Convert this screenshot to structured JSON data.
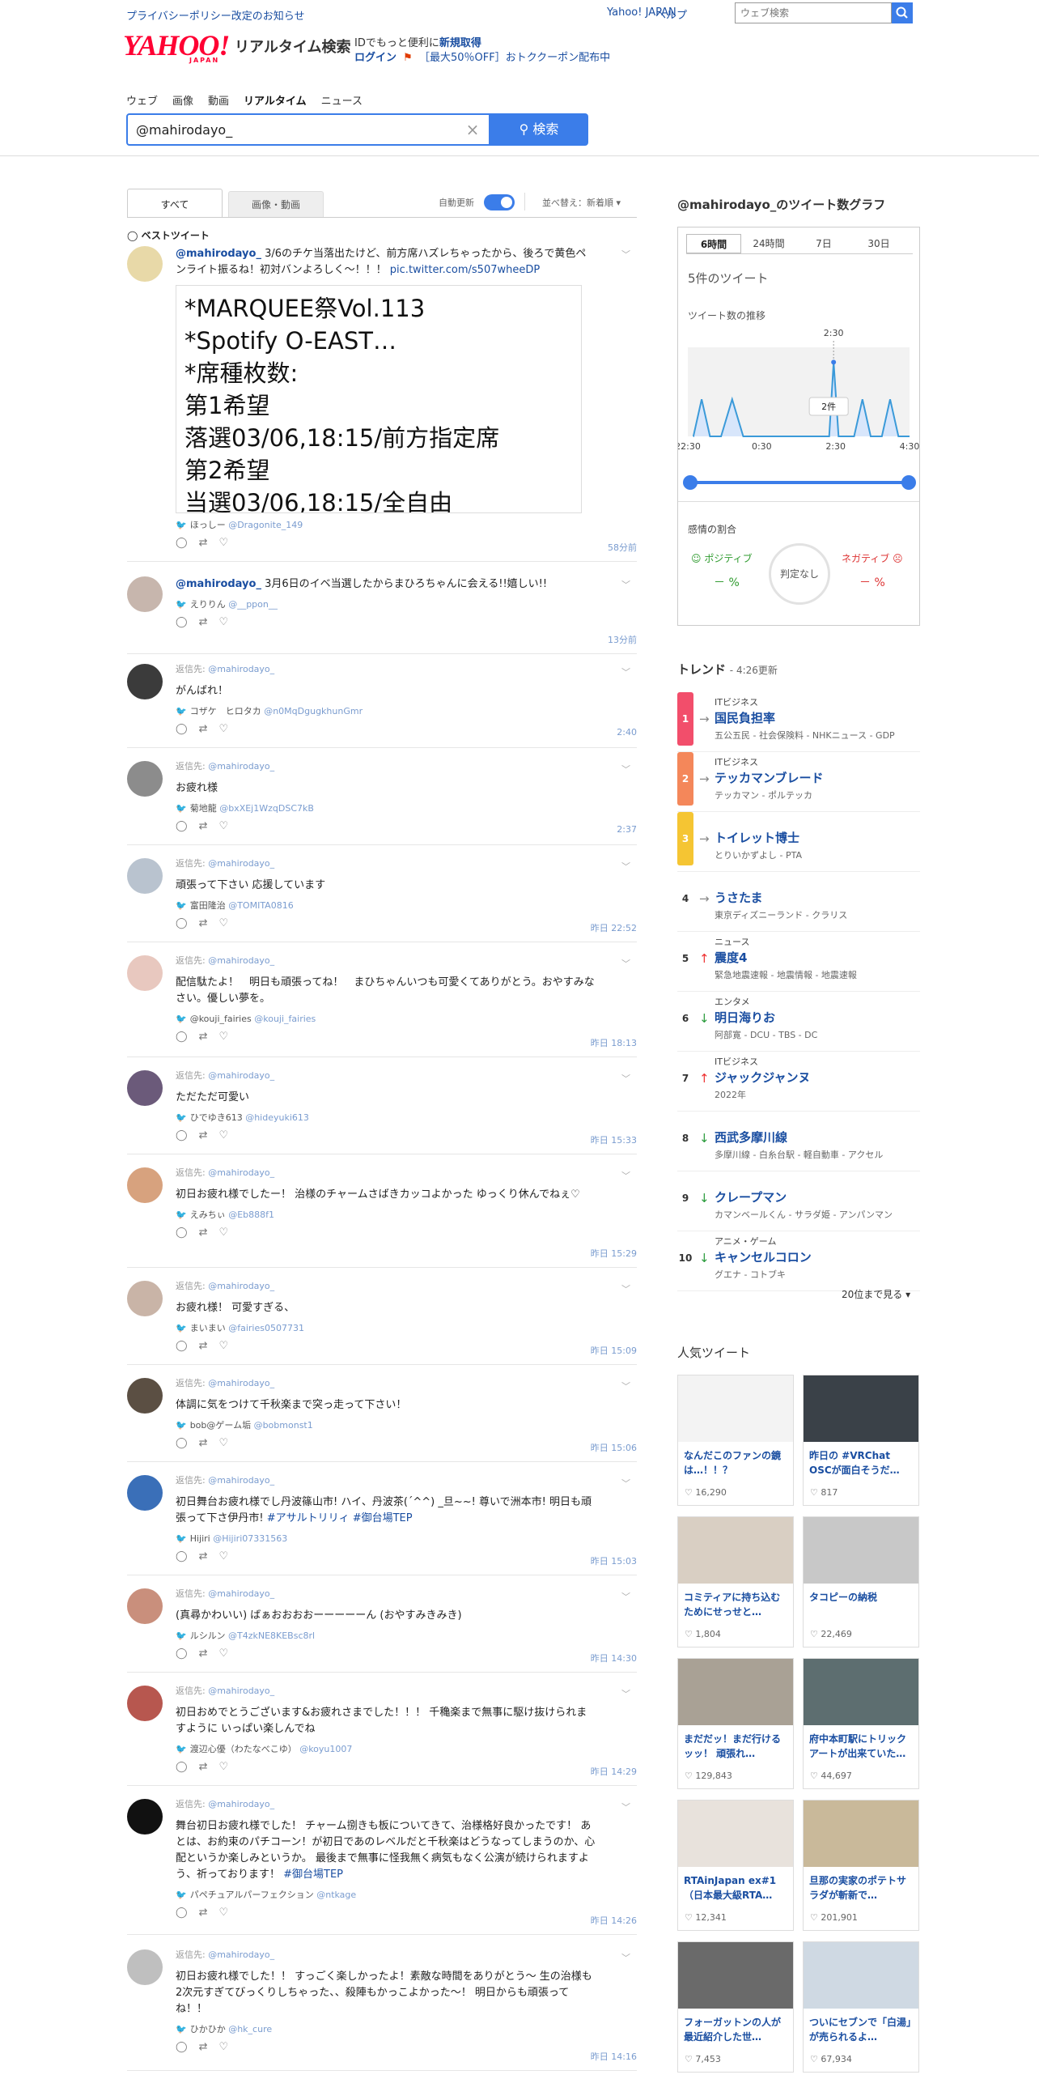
{
  "topbar": {
    "notice": "プライバシーポリシー改定のお知らせ",
    "yjapan": "Yahoo! JAPAN",
    "help": "ヘルプ",
    "websearch_placeholder": "ウェブ検索"
  },
  "header": {
    "logo": "YAHOO!",
    "logo_sub": "JAPAN",
    "service": "リアルタイム検索",
    "id_text": "IDでもっと便利に",
    "id_link": "新規取得",
    "login": "ログイン",
    "coupon_prefix": "［最大50％OFF］",
    "coupon": "おトククーポン配布中"
  },
  "nav": [
    "ウェブ",
    "画像",
    "動画",
    "リアルタイム",
    "ニュース"
  ],
  "search": {
    "value": "@mahirodayo_",
    "button": "検索"
  },
  "tabs": {
    "all": "すべて",
    "media": "画像・動画",
    "auto": "自動更新",
    "sort": "並べ替え：新着順 ▾",
    "best": "ベストツイート"
  },
  "tweets": [
    {
      "user": "@mahirodayo_",
      "text": "3/6のチケ当落出たけど、前方席ハズレちゃったから、後ろで黄色ペンライト振るね！初対バンよろしく〜！！！",
      "link": "pic.twitter.com/s507wheeDP",
      "image_lines": [
        "*MARQUEE祭Vol.113",
        "*Spotify O-EAST…",
        "*席種枚数:",
        "第1希望",
        "落選03/06,18:15/前方指定席",
        "第2希望",
        "当選03/06,18:15/全自由"
      ],
      "name": "ほっしー",
      "handle": "@Dragonite_149",
      "time": "58分前"
    },
    {
      "user": "@mahirodayo_",
      "text": "3月6日のイベ当選したからまひろちゃんに会える!!嬉しい!!",
      "name": "えりりん",
      "handle": "@__ppon__",
      "time": "13分前"
    },
    {
      "reply": "@mahirodayo_",
      "text": "がんばれ！",
      "name": "コザケ　ヒロタカ",
      "handle": "@n0MqDgugkhunGmr",
      "time": "2:40"
    },
    {
      "reply": "@mahirodayo_",
      "text": "お疲れ様",
      "name": "菊地龍",
      "handle": "@bxXEj1WzqDSC7kB",
      "time": "2:37"
    },
    {
      "reply": "@mahirodayo_",
      "text": "頑張って下さい 応援しています",
      "name": "富田隆治",
      "handle": "@TOMITA0816",
      "time": "昨日 22:52"
    },
    {
      "reply": "@mahirodayo_",
      "text": "配信駄たよ！　明日も頑張ってね！　まひちゃんいつも可愛くてありがとう。おやすみなさい。優しい夢を。",
      "name": "@kouji_fairies",
      "handle": "@kouji_fairies",
      "time": "昨日 18:13"
    },
    {
      "reply": "@mahirodayo_",
      "text": "ただただ可愛い",
      "name": "ひでゆき613",
      "handle": "@hideyuki613",
      "time": "昨日 15:33"
    },
    {
      "reply": "@mahirodayo_",
      "text": "初日お疲れ様でしたー！ 治様のチャームさばきカッコよかった ゆっくり休んでねぇ♡",
      "name": "えみちぃ",
      "handle": "@Eb888f1",
      "time": "昨日 15:29"
    },
    {
      "reply": "@mahirodayo_",
      "text": "お疲れ様！ 可愛すぎる、",
      "name": "まいまい",
      "handle": "@fairies0507731",
      "time": "昨日 15:09"
    },
    {
      "reply": "@mahirodayo_",
      "text": "体調に気をつけて千秋楽まで突っ走って下さい！",
      "name": "bob@ゲーム垢",
      "handle": "@bobmonst1",
      "time": "昨日 15:06"
    },
    {
      "reply": "@mahirodayo_",
      "text": "初日舞台お疲れ様でし丹波篠山市! ハイ、丹波茶(´^^) _旦~~! 尊いで洲本市! 明日も頑張って下さ伊丹市!",
      "tags": "#アサルトリリィ #御台場TEP",
      "name": "Hijiri",
      "handle": "@Hijiri07331563",
      "time": "昨日 15:03"
    },
    {
      "reply": "@mahirodayo_",
      "text": "(真尋かわいい) ばぁおおおおーーーーーん (おやすみきみき)",
      "name": "ルシルン",
      "handle": "@T4zkNE8KEBsc8rl",
      "time": "昨日 14:30"
    },
    {
      "reply": "@mahirodayo_",
      "text": "初日おめでとうございます&お疲れさまでした！！！ 千穐楽まで無事に駆け抜けられますように いっぱい楽しんでね",
      "name": "渡辺心優（わたなべこゆ）",
      "handle": "@koyu1007",
      "time": "昨日 14:29"
    },
    {
      "reply": "@mahirodayo_",
      "text": "舞台初日お疲れ様でした！ チャーム捌きも板についてきて、治様格好良かったです！ あとは、お約束のパチコーン！が初日であのレベルだと千秋楽はどうなってしまうのか、心配というか楽しみというか。 最後まで無事に怪我無く病気もなく公演が続けられますよう、祈っております！",
      "tags": "#御台場TEP",
      "name": "パペチュアルパーフェクション",
      "handle": "@ntkage",
      "time": "昨日 14:26"
    },
    {
      "reply": "@mahirodayo_",
      "text": "初日お疲れ様でした！！ すっごく楽しかったよ！素敵な時間をありがとう〜 生の治様も2次元すぎてびっくりしちゃった、、殺陣もかっこよかった〜！ 明日からも頑張ってね！！",
      "name": "ひかひか",
      "handle": "@hk_cure",
      "time": "昨日 14:16"
    }
  ],
  "reply_prefix": "返信先: ",
  "graph": {
    "title": "@mahirodayo_のツイート数グラフ",
    "ranges": [
      "6時間",
      "24時間",
      "7日",
      "30日"
    ],
    "count_text": "5件のツイート",
    "trend_label": "ツイート数の推移",
    "peak_label": "2:30",
    "tooltip": "2件",
    "sentiment_title": "感情の割合",
    "positive": "ポジティブ",
    "negative": "ネガティブ",
    "neutral": "判定なし",
    "pos_value": "－ %",
    "neg_value": "－ %"
  },
  "chart_data": {
    "type": "area",
    "x": [
      "22:30",
      "0:30",
      "2:30",
      "4:30"
    ],
    "x_ticks": [
      "22:30",
      "0:30",
      "2:30",
      "4:30"
    ],
    "points": [
      [
        0.1,
        0
      ],
      [
        0.25,
        1
      ],
      [
        0.4,
        0
      ],
      [
        0.6,
        0
      ],
      [
        0.8,
        1
      ],
      [
        1.0,
        0
      ],
      [
        1.4,
        0
      ],
      [
        1.6,
        0
      ],
      [
        2.0,
        0
      ],
      [
        2.2,
        0
      ],
      [
        2.45,
        0
      ],
      [
        2.55,
        0
      ],
      [
        2.63,
        2
      ],
      [
        2.72,
        0
      ],
      [
        2.9,
        0
      ],
      [
        3.0,
        0
      ],
      [
        3.15,
        1
      ],
      [
        3.3,
        0
      ],
      [
        3.5,
        0
      ],
      [
        3.65,
        1
      ],
      [
        3.8,
        0
      ],
      [
        4.0,
        0
      ]
    ],
    "ylim": [
      0,
      2.4
    ],
    "peak": {
      "x": "2:30",
      "value": 2
    }
  },
  "trends": {
    "title": "トレンド",
    "updated": "4:26更新",
    "more": "20位まで見る ▾",
    "items": [
      {
        "rank": "1",
        "color": "#f24e6b",
        "arrow": "→",
        "arrow_color": "#888",
        "cat": "ITビジネス",
        "kw": "国民負担率",
        "sub": "五公五民 - 社会保険料 - NHKニュース - GDP"
      },
      {
        "rank": "2",
        "color": "#f4875a",
        "arrow": "→",
        "arrow_color": "#888",
        "cat": "ITビジネス",
        "kw": "テッカマンブレード",
        "sub": "テッカマン - ポルテッカ"
      },
      {
        "rank": "3",
        "color": "#f5c533",
        "arrow": "→",
        "arrow_color": "#888",
        "cat": "",
        "kw": "トイレット博士",
        "sub": "とりいかずよし - PTA"
      },
      {
        "rank": "4",
        "color": "#fff",
        "arrow": "→",
        "arrow_color": "#888",
        "cat": "",
        "kw": "うさたま",
        "sub": "東京ディズニーランド - クラリス"
      },
      {
        "rank": "5",
        "color": "#fff",
        "arrow": "↑",
        "arrow_color": "#e33",
        "cat": "ニュース",
        "kw": "震度4",
        "sub": "緊急地震速報 - 地震情報 - 地震速報"
      },
      {
        "rank": "6",
        "color": "#fff",
        "arrow": "↓",
        "arrow_color": "#2a9b3c",
        "cat": "エンタメ",
        "kw": "明日海りお",
        "sub": "阿部寛 - DCU - TBS - DC"
      },
      {
        "rank": "7",
        "color": "#fff",
        "arrow": "↑",
        "arrow_color": "#e33",
        "cat": "ITビジネス",
        "kw": "ジャックジャンヌ",
        "sub": "2022年"
      },
      {
        "rank": "8",
        "color": "#fff",
        "arrow": "↓",
        "arrow_color": "#2a9b3c",
        "cat": "",
        "kw": "西武多摩川線",
        "sub": "多摩川線 - 白糸台駅 - 軽自動車 - アクセル"
      },
      {
        "rank": "9",
        "color": "#fff",
        "arrow": "↓",
        "arrow_color": "#2a9b3c",
        "cat": "",
        "kw": "クレープマン",
        "sub": "カマンベールくん - サラダ姫 - アンパンマン"
      },
      {
        "rank": "10",
        "color": "#fff",
        "arrow": "↓",
        "arrow_color": "#2a9b3c",
        "cat": "アニメ・ゲーム",
        "kw": "キャンセルコロン",
        "sub": "グエナ - コトブキ"
      }
    ]
  },
  "popular": {
    "title": "人気ツイート",
    "items": [
      {
        "cap": "なんだこのファンの鏡は…！！？",
        "likes": "16,290",
        "bg": "#f3f3f3"
      },
      {
        "cap": "昨日の #VRChat OSCが面白そうだ…",
        "likes": "817",
        "bg": "#3a4148"
      },
      {
        "cap": "コミティアに持ち込むためにせっせと…",
        "likes": "1,804",
        "bg": "#d9cfc3"
      },
      {
        "cap": "タコピーの納税",
        "likes": "22,469",
        "bg": "#c8c8c8"
      },
      {
        "cap": "まだだッ！まだ行けるッッ！ 頑張れ…",
        "likes": "129,843",
        "bg": "#a9a195"
      },
      {
        "cap": "府中本町駅にトリックアートが出来ていた…",
        "likes": "44,697",
        "bg": "#5d6e70"
      },
      {
        "cap": "RTAinJapan ex#1（日本最大級RTA…",
        "likes": "12,341",
        "bg": "#e8e2dc"
      },
      {
        "cap": "旦那の実家のポテトサラダが斬新で…",
        "likes": "201,901",
        "bg": "#c9b99a"
      },
      {
        "cap": "フォーガットンの人が最近紹介した世…",
        "likes": "7,453",
        "bg": "#6a6a6a"
      },
      {
        "cap": "ついにセブンで「白湯」が売られるよ…",
        "likes": "67,934",
        "bg": "#cfd9e3"
      }
    ]
  }
}
